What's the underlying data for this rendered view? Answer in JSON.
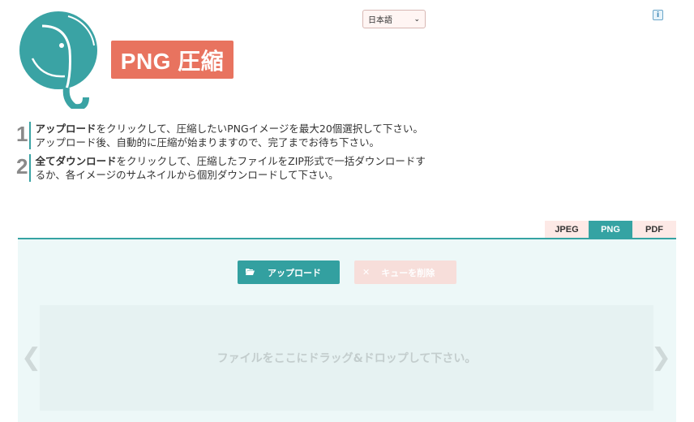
{
  "header": {
    "title": "PNG 圧縮",
    "language_select": {
      "value": "日本語"
    }
  },
  "steps": [
    {
      "number": "1",
      "bold": "アップロード",
      "text": "をクリックして、圧縮したいPNGイメージを最大20個選択して下さい。アップロード後、自動的に圧縮が始まりますので、完了までお待ち下さい。"
    },
    {
      "number": "2",
      "bold": "全てダウンロード",
      "text": "をクリックして、圧縮したファイルをZIP形式で一括ダウンロードするか、各イメージのサムネイルから個別ダウンロードして下さい。"
    }
  ],
  "tabs": [
    {
      "label": "JPEG",
      "active": false
    },
    {
      "label": "PNG",
      "active": true
    },
    {
      "label": "PDF",
      "active": false
    }
  ],
  "toolbar": {
    "upload_label": "アップロード",
    "clear_label": "キューを削除"
  },
  "dropzone": {
    "text": "ファイルをここにドラッグ&ドロップして下さい。"
  },
  "icons": {
    "info": "i",
    "prev": "❮",
    "next": "❯"
  },
  "colors": {
    "accent_teal": "#35a3a3",
    "title_coral": "#e8735f",
    "tab_inactive": "#fde9e6",
    "workspace_bg": "#edf8f8"
  }
}
